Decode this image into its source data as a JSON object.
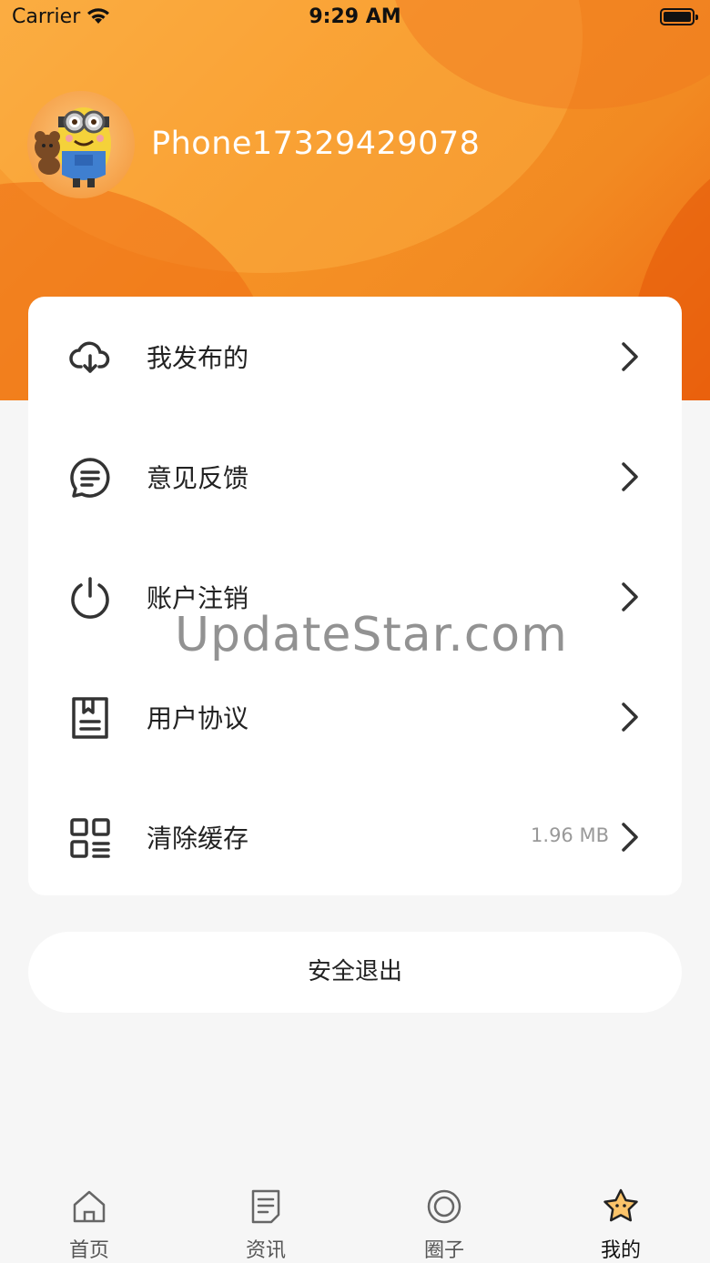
{
  "status_bar": {
    "carrier": "Carrier",
    "time": "9:29 AM"
  },
  "profile": {
    "username": "Phone17329429078"
  },
  "menu": {
    "items": [
      {
        "label": "我发布的",
        "icon": "cloud-download-icon"
      },
      {
        "label": "意见反馈",
        "icon": "chat-bubble-icon"
      },
      {
        "label": "账户注销",
        "icon": "power-icon"
      },
      {
        "label": "用户协议",
        "icon": "document-bookmark-icon"
      },
      {
        "label": "清除缓存",
        "icon": "grid-list-icon",
        "detail": "1.96 MB"
      }
    ]
  },
  "logout": {
    "label": "安全退出"
  },
  "watermark": {
    "text": "UpdateStar.com"
  },
  "tabbar": {
    "tabs": [
      {
        "label": "首页",
        "icon": "home-icon"
      },
      {
        "label": "资讯",
        "icon": "news-icon"
      },
      {
        "label": "圈子",
        "icon": "circle-icon"
      },
      {
        "label": "我的",
        "icon": "star-face-icon",
        "active": true
      }
    ]
  },
  "colors": {
    "accent": "#f28a22",
    "background": "#f6f6f6"
  }
}
